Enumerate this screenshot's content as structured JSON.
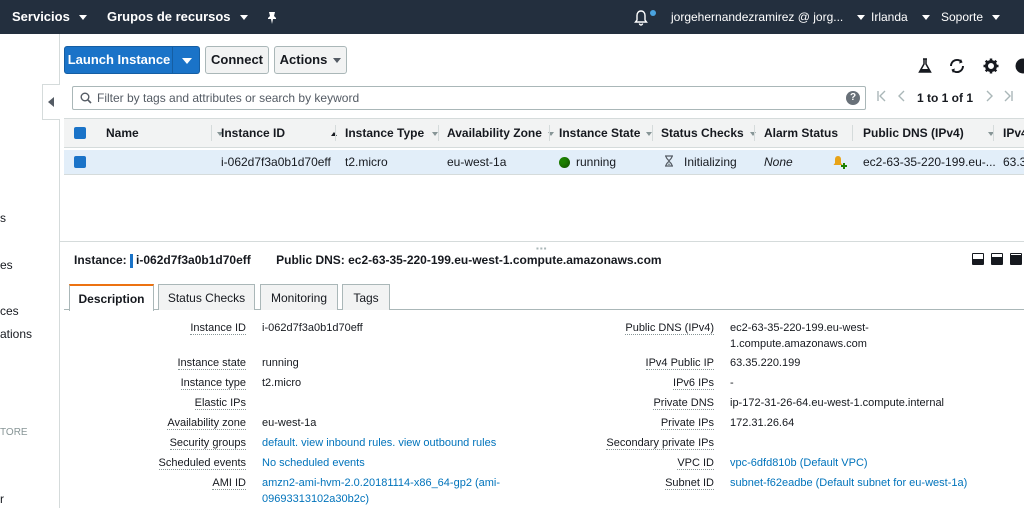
{
  "topnav": {
    "services": "Servicios",
    "resource_groups": "Grupos de recursos",
    "account": "jorgehernandezramirez @ jorg...",
    "region": "Irlanda",
    "support": "Soporte"
  },
  "sidebar": {
    "fragments": [
      "s",
      "es",
      "ces",
      "ations",
      "TORE",
      "r"
    ]
  },
  "toolbar": {
    "launch_label": "Launch Instance",
    "connect_label": "Connect",
    "actions_label": "Actions"
  },
  "filter": {
    "placeholder": "Filter by tags and attributes or search by keyword",
    "pagination": "1 to 1 of 1"
  },
  "table": {
    "columns": [
      "Name",
      "Instance ID",
      "Instance Type",
      "Availability Zone",
      "Instance State",
      "Status Checks",
      "Alarm Status",
      "Public DNS (IPv4)",
      "IPv4"
    ],
    "rows": [
      {
        "name": "",
        "instance_id": "i-062d7f3a0b1d70eff",
        "instance_type": "t2.micro",
        "availability_zone": "eu-west-1a",
        "instance_state": "running",
        "status_checks": "Initializing",
        "alarm_status": "None",
        "public_dns": "ec2-63-35-220-199.eu-...",
        "ipv4": "63.3"
      }
    ]
  },
  "details": {
    "instance_label": "Instance:",
    "instance_id": "i-062d7f3a0b1d70eff",
    "public_dns_label": "Public DNS:",
    "public_dns": "ec2-63-35-220-199.eu-west-1.compute.amazonaws.com",
    "tabs": [
      "Description",
      "Status Checks",
      "Monitoring",
      "Tags"
    ],
    "left": [
      {
        "label": "Instance ID",
        "value": "i-062d7f3a0b1d70eff",
        "link": false
      },
      {
        "label": "Instance state",
        "value": "running",
        "link": false
      },
      {
        "label": "Instance type",
        "value": "t2.micro",
        "link": false
      },
      {
        "label": "Elastic IPs",
        "value": "",
        "link": false
      },
      {
        "label": "Availability zone",
        "value": "eu-west-1a",
        "link": false
      },
      {
        "label": "Security groups",
        "value": "default. view inbound rules. view outbound rules",
        "link": true
      },
      {
        "label": "Scheduled events",
        "value": "No scheduled events",
        "link": true
      },
      {
        "label": "AMI ID",
        "value": "amzn2-ami-hvm-2.0.20181114-x86_64-gp2 (ami-09693313102a30b2c)",
        "link": true
      }
    ],
    "right": [
      {
        "label": "Public DNS (IPv4)",
        "value": "ec2-63-35-220-199.eu-west-1.compute.amazonaws.com",
        "link": false
      },
      {
        "label": "IPv4 Public IP",
        "value": "63.35.220.199",
        "link": false
      },
      {
        "label": "IPv6 IPs",
        "value": "-",
        "link": false
      },
      {
        "label": "Private DNS",
        "value": "ip-172-31-26-64.eu-west-1.compute.internal",
        "link": false
      },
      {
        "label": "Private IPs",
        "value": "172.31.26.64",
        "link": false
      },
      {
        "label": "Secondary private IPs",
        "value": "",
        "link": false
      },
      {
        "label": "VPC ID",
        "value": "vpc-6dfd810b (Default VPC)",
        "link": true
      },
      {
        "label": "Subnet ID",
        "value": "subnet-f62eadbe (Default subnet for eu-west-1a)",
        "link": true
      }
    ]
  }
}
